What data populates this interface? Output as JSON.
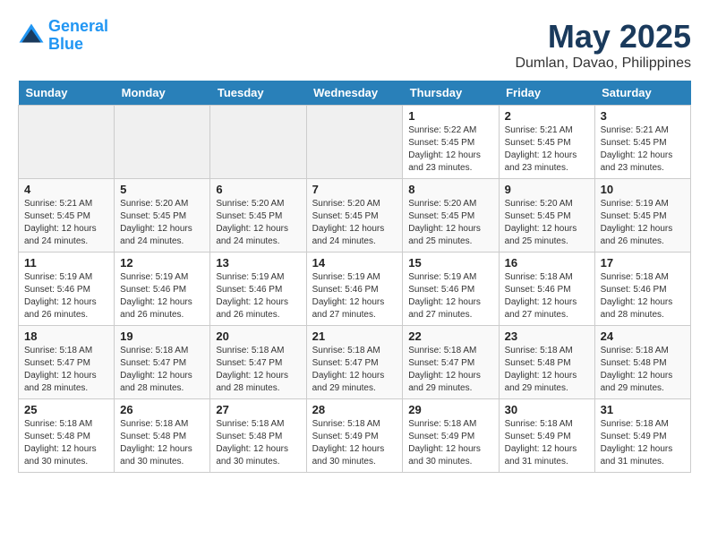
{
  "header": {
    "logo_line1": "General",
    "logo_line2": "Blue",
    "title": "May 2025",
    "subtitle": "Dumlan, Davao, Philippines"
  },
  "days_of_week": [
    "Sunday",
    "Monday",
    "Tuesday",
    "Wednesday",
    "Thursday",
    "Friday",
    "Saturday"
  ],
  "weeks": [
    [
      {
        "day": "",
        "info": ""
      },
      {
        "day": "",
        "info": ""
      },
      {
        "day": "",
        "info": ""
      },
      {
        "day": "",
        "info": ""
      },
      {
        "day": "1",
        "info": "Sunrise: 5:22 AM\nSunset: 5:45 PM\nDaylight: 12 hours\nand 23 minutes."
      },
      {
        "day": "2",
        "info": "Sunrise: 5:21 AM\nSunset: 5:45 PM\nDaylight: 12 hours\nand 23 minutes."
      },
      {
        "day": "3",
        "info": "Sunrise: 5:21 AM\nSunset: 5:45 PM\nDaylight: 12 hours\nand 23 minutes."
      }
    ],
    [
      {
        "day": "4",
        "info": "Sunrise: 5:21 AM\nSunset: 5:45 PM\nDaylight: 12 hours\nand 24 minutes."
      },
      {
        "day": "5",
        "info": "Sunrise: 5:20 AM\nSunset: 5:45 PM\nDaylight: 12 hours\nand 24 minutes."
      },
      {
        "day": "6",
        "info": "Sunrise: 5:20 AM\nSunset: 5:45 PM\nDaylight: 12 hours\nand 24 minutes."
      },
      {
        "day": "7",
        "info": "Sunrise: 5:20 AM\nSunset: 5:45 PM\nDaylight: 12 hours\nand 24 minutes."
      },
      {
        "day": "8",
        "info": "Sunrise: 5:20 AM\nSunset: 5:45 PM\nDaylight: 12 hours\nand 25 minutes."
      },
      {
        "day": "9",
        "info": "Sunrise: 5:20 AM\nSunset: 5:45 PM\nDaylight: 12 hours\nand 25 minutes."
      },
      {
        "day": "10",
        "info": "Sunrise: 5:19 AM\nSunset: 5:45 PM\nDaylight: 12 hours\nand 26 minutes."
      }
    ],
    [
      {
        "day": "11",
        "info": "Sunrise: 5:19 AM\nSunset: 5:46 PM\nDaylight: 12 hours\nand 26 minutes."
      },
      {
        "day": "12",
        "info": "Sunrise: 5:19 AM\nSunset: 5:46 PM\nDaylight: 12 hours\nand 26 minutes."
      },
      {
        "day": "13",
        "info": "Sunrise: 5:19 AM\nSunset: 5:46 PM\nDaylight: 12 hours\nand 26 minutes."
      },
      {
        "day": "14",
        "info": "Sunrise: 5:19 AM\nSunset: 5:46 PM\nDaylight: 12 hours\nand 27 minutes."
      },
      {
        "day": "15",
        "info": "Sunrise: 5:19 AM\nSunset: 5:46 PM\nDaylight: 12 hours\nand 27 minutes."
      },
      {
        "day": "16",
        "info": "Sunrise: 5:18 AM\nSunset: 5:46 PM\nDaylight: 12 hours\nand 27 minutes."
      },
      {
        "day": "17",
        "info": "Sunrise: 5:18 AM\nSunset: 5:46 PM\nDaylight: 12 hours\nand 28 minutes."
      }
    ],
    [
      {
        "day": "18",
        "info": "Sunrise: 5:18 AM\nSunset: 5:47 PM\nDaylight: 12 hours\nand 28 minutes."
      },
      {
        "day": "19",
        "info": "Sunrise: 5:18 AM\nSunset: 5:47 PM\nDaylight: 12 hours\nand 28 minutes."
      },
      {
        "day": "20",
        "info": "Sunrise: 5:18 AM\nSunset: 5:47 PM\nDaylight: 12 hours\nand 28 minutes."
      },
      {
        "day": "21",
        "info": "Sunrise: 5:18 AM\nSunset: 5:47 PM\nDaylight: 12 hours\nand 29 minutes."
      },
      {
        "day": "22",
        "info": "Sunrise: 5:18 AM\nSunset: 5:47 PM\nDaylight: 12 hours\nand 29 minutes."
      },
      {
        "day": "23",
        "info": "Sunrise: 5:18 AM\nSunset: 5:48 PM\nDaylight: 12 hours\nand 29 minutes."
      },
      {
        "day": "24",
        "info": "Sunrise: 5:18 AM\nSunset: 5:48 PM\nDaylight: 12 hours\nand 29 minutes."
      }
    ],
    [
      {
        "day": "25",
        "info": "Sunrise: 5:18 AM\nSunset: 5:48 PM\nDaylight: 12 hours\nand 30 minutes."
      },
      {
        "day": "26",
        "info": "Sunrise: 5:18 AM\nSunset: 5:48 PM\nDaylight: 12 hours\nand 30 minutes."
      },
      {
        "day": "27",
        "info": "Sunrise: 5:18 AM\nSunset: 5:48 PM\nDaylight: 12 hours\nand 30 minutes."
      },
      {
        "day": "28",
        "info": "Sunrise: 5:18 AM\nSunset: 5:49 PM\nDaylight: 12 hours\nand 30 minutes."
      },
      {
        "day": "29",
        "info": "Sunrise: 5:18 AM\nSunset: 5:49 PM\nDaylight: 12 hours\nand 30 minutes."
      },
      {
        "day": "30",
        "info": "Sunrise: 5:18 AM\nSunset: 5:49 PM\nDaylight: 12 hours\nand 31 minutes."
      },
      {
        "day": "31",
        "info": "Sunrise: 5:18 AM\nSunset: 5:49 PM\nDaylight: 12 hours\nand 31 minutes."
      }
    ]
  ]
}
